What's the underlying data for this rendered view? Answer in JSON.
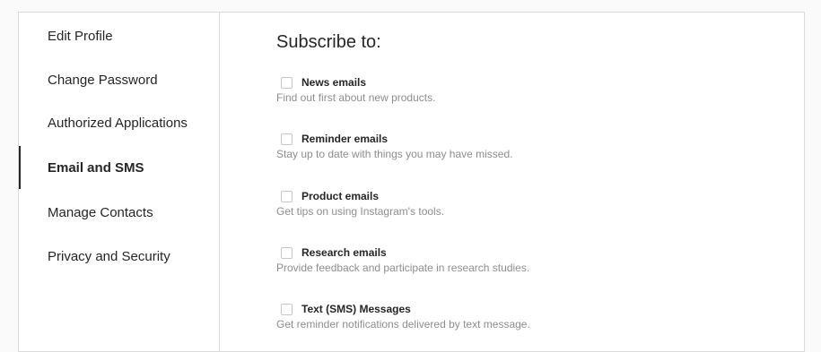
{
  "sidebar": {
    "items": [
      {
        "label": "Edit Profile"
      },
      {
        "label": "Change Password"
      },
      {
        "label": "Authorized Applications"
      },
      {
        "label": "Email and SMS"
      },
      {
        "label": "Manage Contacts"
      },
      {
        "label": "Privacy and Security"
      }
    ],
    "active_item": "Email and SMS"
  },
  "main": {
    "title": "Subscribe to:",
    "options": [
      {
        "label": "News emails",
        "description": "Find out first about new products.",
        "checked": false
      },
      {
        "label": "Reminder emails",
        "description": "Stay up to date with things you may have missed.",
        "checked": false
      },
      {
        "label": "Product emails",
        "description": "Get tips on using Instagram's tools.",
        "checked": false
      },
      {
        "label": "Research emails",
        "description": "Provide feedback and participate in research studies.",
        "checked": false
      },
      {
        "label": "Text (SMS) Messages",
        "description": "Get reminder notifications delivered by text message.",
        "checked": false
      }
    ]
  },
  "colors": {
    "text": "#262626",
    "secondary_text": "#8e8e8e",
    "border": "#dbdbdb",
    "background": "#fafafa",
    "panel": "#ffffff"
  }
}
